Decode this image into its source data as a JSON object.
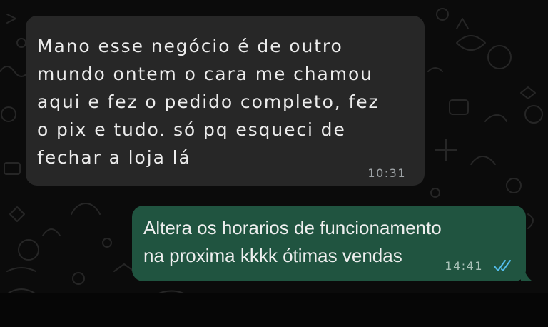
{
  "theme": {
    "background": "#0b0b0b",
    "incoming_bubble": "#272727",
    "outgoing_bubble": "#205440",
    "read_receipt": "#53bdeb"
  },
  "messages": [
    {
      "direction": "incoming",
      "lines": [
        "Mano esse negócio é de outro",
        "mundo ontem o cara me chamou",
        "aqui e fez o pedido completo, fez",
        "o pix e tudo. só pq esqueci de",
        "fechar a loja lá"
      ],
      "time": "10:31"
    },
    {
      "direction": "outgoing",
      "lines": [
        "Altera os horarios de funcionamento",
        "na proxima kkkk ótimas vendas"
      ],
      "time": "14:41",
      "status_icon": "double-check-read-icon"
    }
  ]
}
